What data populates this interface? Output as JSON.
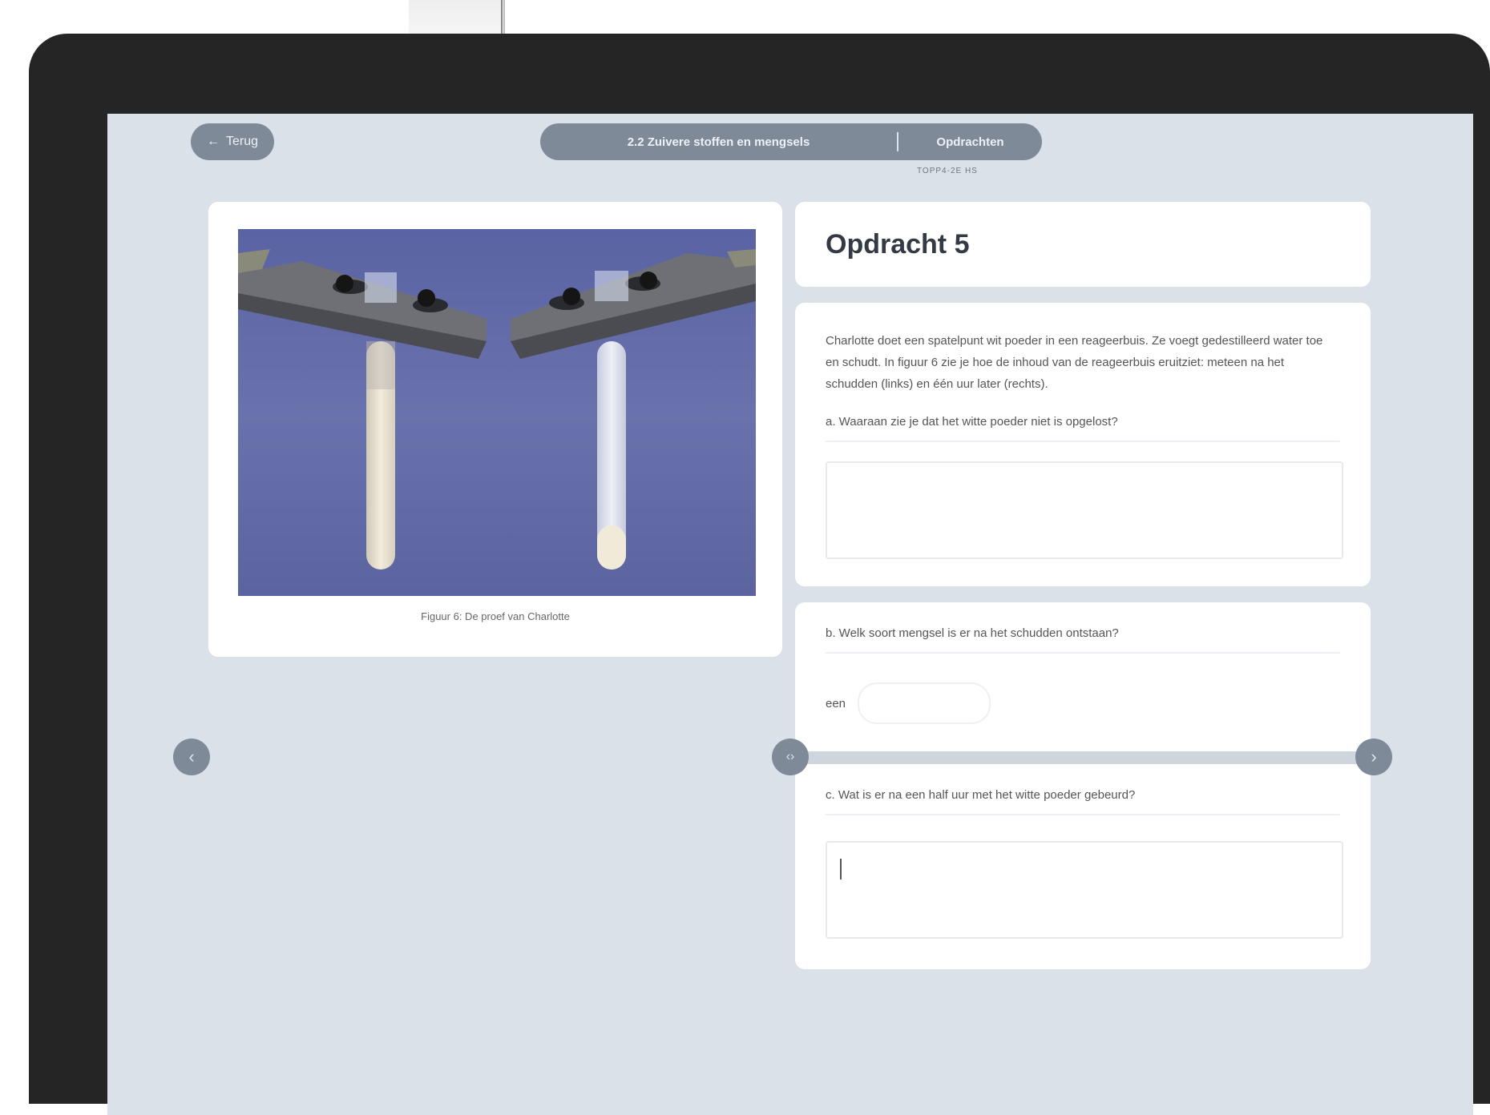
{
  "header": {
    "back_label": "Terug",
    "chapter": "2.2 Zuivere stoffen en mengsels",
    "section": "Opdrachten",
    "sub_code": "TOPP4-2E HS"
  },
  "figure": {
    "caption": "Figuur 6: De proef van Charlotte"
  },
  "assignment": {
    "title": "Opdracht 5",
    "intro": "Charlotte doet een spatelpunt wit poeder in een reageerbuis. Ze voegt gedestilleerd water toe en schudt. In figuur 6 zie je hoe de inhoud van de reageerbuis eruitziet: meteen na het schudden (links) en één uur later (rechts).",
    "question_a": "a. Waaraan zie je dat het witte poeder niet is opgelost?",
    "question_b": "b. Welk soort mengsel is er na het schudden ontstaan?",
    "question_b_prefix": "een",
    "question_c": "c. Wat is er na een half uur met het witte poeder gebeurd?"
  },
  "icons": {
    "back": "arrow-left-icon",
    "prev": "chevron-left-icon",
    "split": "split-handle-icon",
    "next": "chevron-right-icon"
  }
}
